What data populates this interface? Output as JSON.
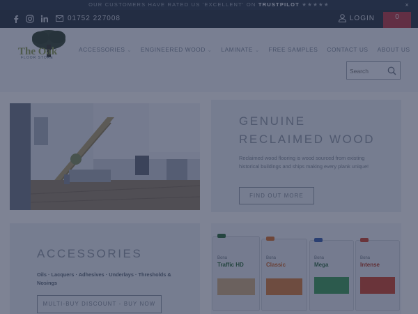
{
  "announcement": {
    "prefix": "OUR CUSTOMERS HAVE RATED US 'EXCELLENT' ON",
    "brand": "TRUSTPILOT",
    "suffix": "★★★★★",
    "close": "×"
  },
  "contact": {
    "social_icons": [
      "facebook-icon",
      "instagram-icon",
      "linkedin-icon"
    ],
    "phone_icon": "envelope-icon",
    "phone": "01752 227008",
    "login_label": "LOGIN",
    "cart_label": "0"
  },
  "header": {
    "logo_text": "The Oak",
    "logo_sub": "FLOOR STORE",
    "nav": [
      {
        "label": "ACCESSORIES",
        "dropdown": true
      },
      {
        "label": "ENGINEERED WOOD",
        "dropdown": true
      },
      {
        "label": "LAMINATE",
        "dropdown": true
      },
      {
        "label": "FREE SAMPLES",
        "dropdown": false
      },
      {
        "label": "CONTACT US",
        "dropdown": false
      },
      {
        "label": "ABOUT US",
        "dropdown": false
      }
    ],
    "search_placeholder": "Search"
  },
  "hero": {
    "title_line1": "GENUINE",
    "title_line2": "RECLAIMED WOOD",
    "description": "Reclaimed wood flooring is wood sourced from existing historical buildings and ships making every plank unique!",
    "button": "FIND OUT MORE"
  },
  "accessories": {
    "title": "ACCESSORIES",
    "list": "Oils · Lacquers · Adhesives · Underlays · Thresholds & Nosings",
    "button": "MULTI-BUY DISCOUNT - BUY NOW"
  },
  "products": [
    {
      "brand": "Bona",
      "name": "Traffic HD",
      "color": "#3d8a4c"
    },
    {
      "brand": "Bona",
      "name": "Classic",
      "color": "#d06d2b"
    },
    {
      "brand": "Bona",
      "name": "Mega",
      "color": "#3f9a58"
    },
    {
      "brand": "Bona",
      "name": "Intense",
      "color": "#c8452e"
    }
  ],
  "colors": {
    "topbar": "#2d3b4a",
    "cart": "#b53a44",
    "overlay": "#1e2646"
  }
}
